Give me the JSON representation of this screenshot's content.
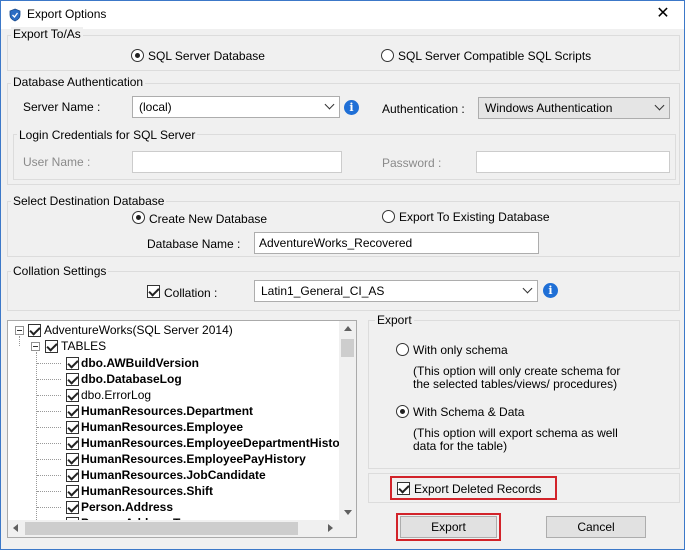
{
  "window": {
    "title": "Export Options",
    "close_glyph": "✕"
  },
  "export_to": {
    "legend": "Export To/As",
    "options": [
      {
        "label": "SQL Server Database",
        "selected": true
      },
      {
        "label": "SQL Server Compatible SQL Scripts",
        "selected": false
      }
    ]
  },
  "db_auth": {
    "legend": "Database Authentication",
    "server_name_label": "Server Name :",
    "server_name_value": "(local)",
    "authentication_label": "Authentication :",
    "authentication_value": "Windows Authentication",
    "login": {
      "legend": "Login Credentials for SQL Server",
      "user_name_label": "User Name :",
      "password_label": "Password :"
    }
  },
  "destination": {
    "legend": "Select Destination Database",
    "options": [
      {
        "label": "Create New Database",
        "selected": true
      },
      {
        "label": "Export To Existing Database",
        "selected": false
      }
    ],
    "db_name_label": "Database Name :",
    "db_name_value": "AdventureWorks_Recovered"
  },
  "collation": {
    "legend": "Collation Settings",
    "checkbox_label": "Collation :",
    "checked": true,
    "value": "Latin1_General_CI_AS"
  },
  "tree": {
    "root": "AdventureWorks(SQL Server 2014)",
    "folder": "TABLES",
    "items": [
      {
        "label": "dbo.AWBuildVersion",
        "bold": true
      },
      {
        "label": "dbo.DatabaseLog",
        "bold": true
      },
      {
        "label": "dbo.ErrorLog",
        "bold": false
      },
      {
        "label": "HumanResources.Department",
        "bold": true
      },
      {
        "label": "HumanResources.Employee",
        "bold": true
      },
      {
        "label": "HumanResources.EmployeeDepartmentHistory",
        "bold": true
      },
      {
        "label": "HumanResources.EmployeePayHistory",
        "bold": true
      },
      {
        "label": "HumanResources.JobCandidate",
        "bold": true
      },
      {
        "label": "HumanResources.Shift",
        "bold": true
      },
      {
        "label": "Person.Address",
        "bold": true
      },
      {
        "label": "Person.AddressType",
        "bold": true
      }
    ]
  },
  "export_panel": {
    "legend": "Export",
    "schema_only_label": "With only schema",
    "schema_only_desc_1": "(This option will only create schema for",
    "schema_only_desc_2": "the  selected tables/views/ procedures)",
    "schema_data_label": "With Schema & Data",
    "schema_data_desc_1": "(This option will export schema as well",
    "schema_data_desc_2": "data for the table)"
  },
  "export_deleted": {
    "label": "Export Deleted Records",
    "checked": true
  },
  "buttons": {
    "export": "Export",
    "cancel": "Cancel"
  },
  "colors": {
    "highlight": "#d2232a",
    "info": "#1f6fd6",
    "window_border": "#3c78c8"
  }
}
